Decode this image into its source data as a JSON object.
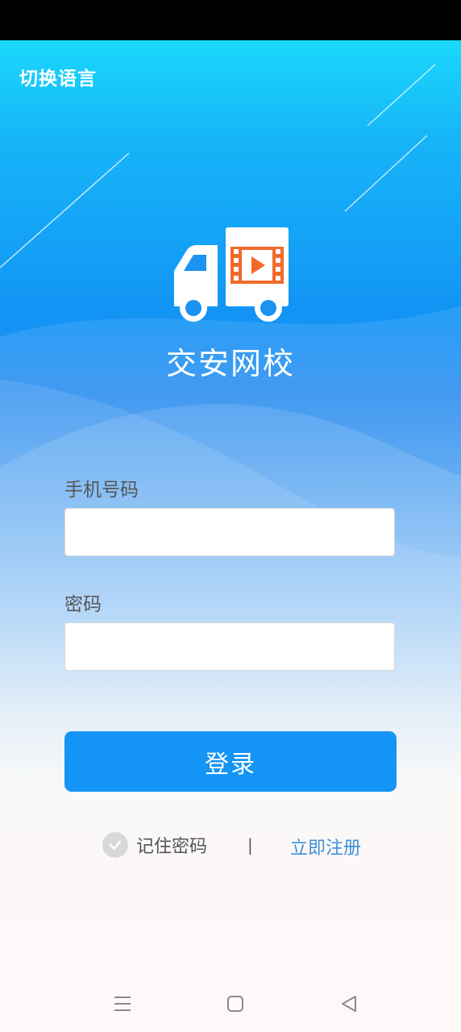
{
  "header": {
    "language_switch": "切换语言"
  },
  "branding": {
    "app_name": "交安网校",
    "logo_icon": "truck-video-icon"
  },
  "form": {
    "phone_label": "手机号码",
    "phone_value": "",
    "password_label": "密码",
    "password_value": "",
    "login_button": "登录",
    "remember_label": "记住密码",
    "remember_checked": false,
    "divider": "|",
    "register_link": "立即注册"
  },
  "colors": {
    "primary": "#1495f5",
    "link": "#3f8fd8",
    "logo_accent": "#f26a2a"
  },
  "system_nav": {
    "icons": [
      "menu-icon",
      "home-icon",
      "back-icon"
    ]
  }
}
